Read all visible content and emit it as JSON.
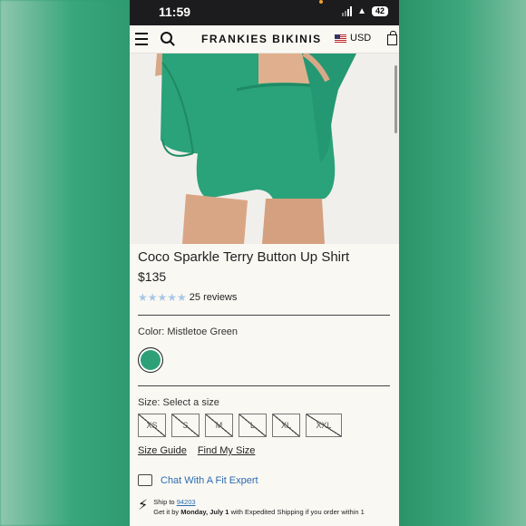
{
  "status_bar": {
    "time": "11:59",
    "battery": "42"
  },
  "nav": {
    "brand": "FRANKIES BIKINIS",
    "currency": "USD"
  },
  "product": {
    "title": "Coco Sparkle Terry Button Up Shirt",
    "price": "$135",
    "rating": {
      "stars": 5,
      "stars_glyphs": "★★★★★",
      "reviews": "25 reviews"
    },
    "color_label": "Color: Mistletoe Green",
    "swatch_color": "#2da078",
    "size_label": "Size: Select a size",
    "sizes": [
      "XS",
      "S",
      "M",
      "L",
      "XL",
      "XXL"
    ],
    "size_guide": "Size Guide",
    "find_my_size": "Find My Size",
    "chat": "Chat With A Fit Expert"
  },
  "shipping": {
    "ship_to_prefix": "Ship to",
    "zip": "94203",
    "get_it_by": "Get it by",
    "date": "Monday, July 1",
    "suffix": "with Expedited Shipping if you order within 1"
  },
  "colors": {
    "accent_green": "#2da078",
    "link_blue": "#2b6cb0",
    "star_blue": "#a7c8e6"
  }
}
